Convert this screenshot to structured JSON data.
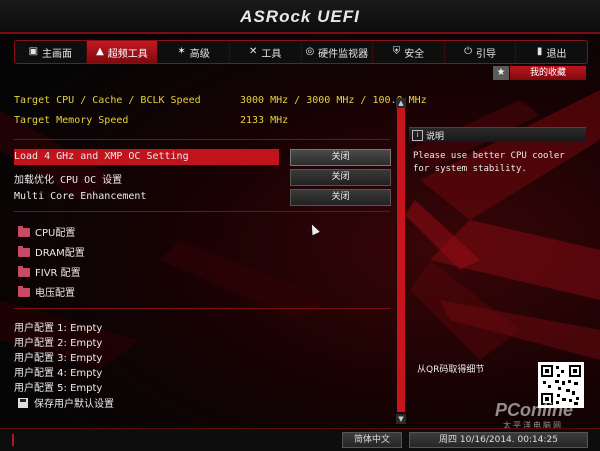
{
  "header": {
    "brand": "ASRock UEFI"
  },
  "tabs": [
    {
      "label": "主画面",
      "icon": "home-icon",
      "active": false
    },
    {
      "label": "超频工具",
      "icon": "flame-icon",
      "active": true
    },
    {
      "label": "高级",
      "icon": "star-icon",
      "active": false
    },
    {
      "label": "工具",
      "icon": "tools-icon",
      "active": false
    },
    {
      "label": "硬件监视器",
      "icon": "monitor-icon",
      "active": false
    },
    {
      "label": "安全",
      "icon": "shield-icon",
      "active": false
    },
    {
      "label": "引导",
      "icon": "power-icon",
      "active": false
    },
    {
      "label": "退出",
      "icon": "exit-icon",
      "active": false
    }
  ],
  "favorites": {
    "label": "我的收藏",
    "icon": "star-icon"
  },
  "info": [
    {
      "label": "Target CPU / Cache / BCLK Speed",
      "value": "3000 MHz / 3000 MHz / 100.0 MHz"
    },
    {
      "label": "Target Memory Speed",
      "value": "2133 MHz"
    }
  ],
  "options": [
    {
      "label": "Load 4 GHz and XMP OC Setting",
      "value": "关闭",
      "highlighted": true
    },
    {
      "label": "加载优化 CPU OC 设置",
      "value": "关闭",
      "highlighted": false
    },
    {
      "label": "Multi Core Enhancement",
      "value": "关闭",
      "highlighted": false
    }
  ],
  "submenus": [
    {
      "label": "CPU配置",
      "icon": "folder-icon"
    },
    {
      "label": "DRAM配置",
      "icon": "folder-icon"
    },
    {
      "label": "FIVR 配置",
      "icon": "folder-icon"
    },
    {
      "label": "电压配置",
      "icon": "folder-icon"
    }
  ],
  "profiles": [
    {
      "label": "用户配置 1: Empty"
    },
    {
      "label": "用户配置 2: Empty"
    },
    {
      "label": "用户配置 3: Empty"
    },
    {
      "label": "用户配置 4: Empty"
    },
    {
      "label": "用户配置 5: Empty"
    }
  ],
  "save_default": {
    "label": "保存用户默认设置",
    "icon": "save-icon"
  },
  "description": {
    "title": "说明",
    "text": "Please use better CPU cooler for system stability."
  },
  "qr": {
    "label": "从QR码取得细节"
  },
  "footer": {
    "language": "简体中文",
    "datetime": "周四 10/16/2014. 00:14:25"
  },
  "watermark": {
    "main": "PConline",
    "sub": "太平洋电脑网"
  },
  "colors": {
    "accent": "#c0131b",
    "highlight_text": "#e5d33a"
  }
}
